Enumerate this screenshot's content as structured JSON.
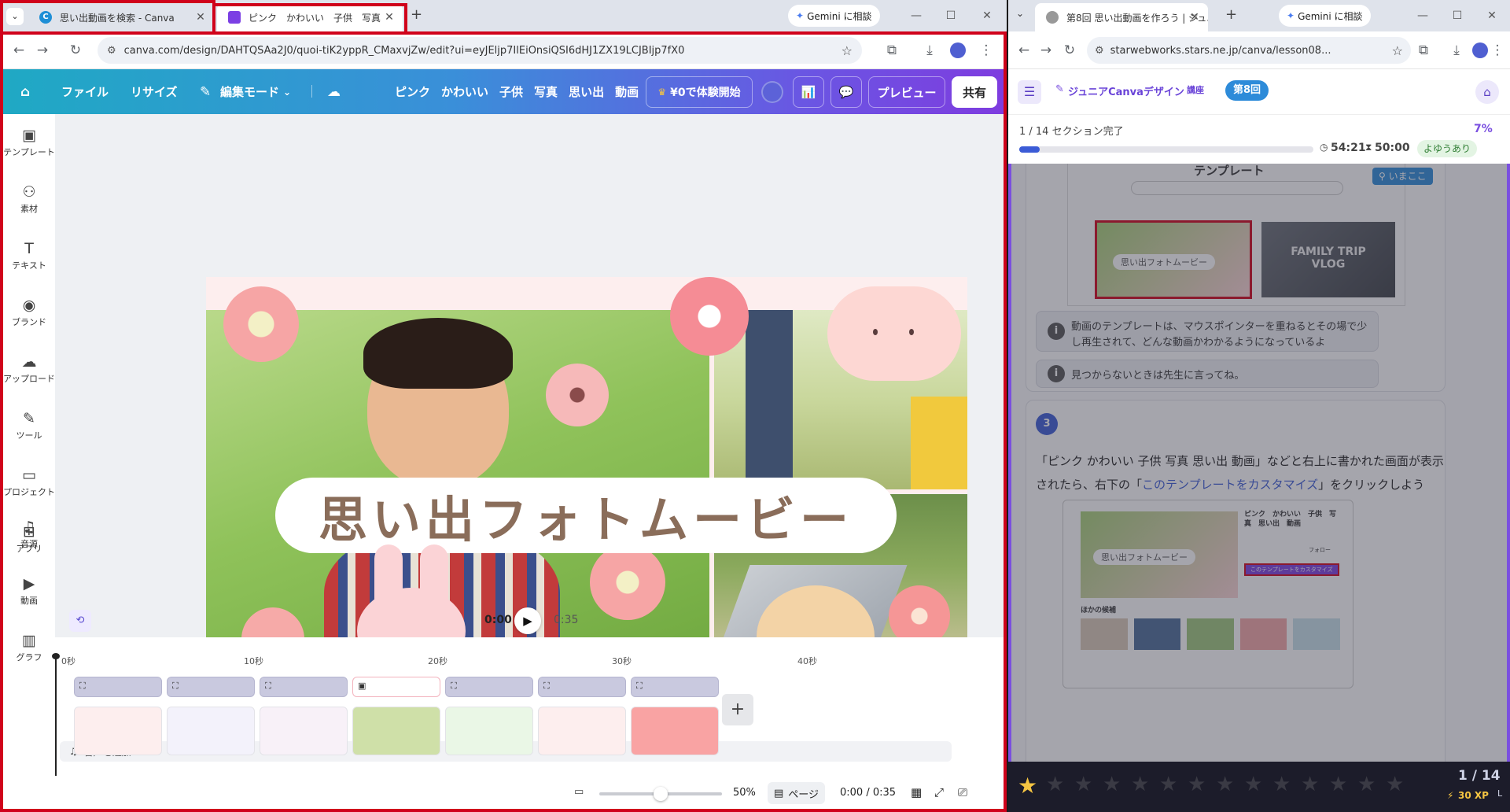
{
  "left_window": {
    "tabs": [
      {
        "title": "思い出動画を検索 - Canva"
      },
      {
        "title": "ピンク　かわいい　子供　写真"
      }
    ],
    "gemini": "Gemini に相談",
    "url": "canva.com/design/DAHTQSAa2J0/quoi-tiK2yppR_CMaxvjZw/edit?ui=eyJEljp7IlEiOnsiQSI6dHJ1ZX19LCJBIjp7fX0"
  },
  "canva": {
    "header": {
      "file": "ファイル",
      "resize": "リサイズ",
      "edit_mode": "編集モード",
      "keywords": [
        "ピンク",
        "かわいい",
        "子供",
        "写真",
        "思い出",
        "動画"
      ],
      "trial": "¥0で体験開始",
      "preview": "プレビュー",
      "share": "共有"
    },
    "sidebar": [
      {
        "label": "テンプレート",
        "icon": "template-icon"
      },
      {
        "label": "素材",
        "icon": "elements-icon"
      },
      {
        "label": "テキスト",
        "icon": "text-icon"
      },
      {
        "label": "ブランド",
        "icon": "brand-icon"
      },
      {
        "label": "アップロード",
        "icon": "upload-icon"
      },
      {
        "label": "ツール",
        "icon": "tools-icon"
      },
      {
        "label": "プロジェクト",
        "icon": "folder-icon"
      },
      {
        "label": "アプリ",
        "icon": "apps-icon"
      },
      {
        "label": "音源",
        "icon": "music-icon"
      },
      {
        "label": "動画",
        "icon": "video-icon"
      },
      {
        "label": "グラフ",
        "icon": "chart-icon"
      }
    ],
    "design_title": "思い出フォトムービー",
    "playback": {
      "current": "0:00",
      "total": "0:35"
    },
    "ruler": [
      "0秒",
      "10秒",
      "20秒",
      "30秒",
      "40秒"
    ],
    "add_audio": "音声を追加",
    "status": {
      "zoom": "50%",
      "zoom_level": 0.5,
      "pages": "ページ",
      "time": "0:00 / 0:35"
    }
  },
  "right_window": {
    "tab": "第8回 思い出動画を作ろう | ジュニ",
    "gemini": "Gemini に相談",
    "url": "starwebworks.stars.ne.jp/canva/lesson08...",
    "course": "ジュニアCanvaデザイン",
    "course_badge": "講座",
    "lesson_badge": "第8回",
    "progress_text": "1 / 14 セクション完了",
    "progress_pct": "7%",
    "progress_fraction": 0.07,
    "timer1": "54:21",
    "timer2": "50:00",
    "timer_status": "よゆうあり",
    "shot1": {
      "heading": "テンプレート",
      "here_tag": "いまここ",
      "thumb2_title": "FAMILY TRIP VLOG",
      "thumb1_title": "思い出フォトムービー"
    },
    "notes": [
      "動画のテンプレートは、マウスポインターを重ねるとその場で少し再生されて、どんな動画かわかるようになっているよ",
      "見つからないときは先生に言ってね。"
    ],
    "step_no": "3",
    "step_text_1": "「ピンク かわいい 子供 写真 思い出 動画」などと右上に書かれた画面が表示されたら、右下の「",
    "step_link": "このテンプレートをカスタマイズ",
    "step_text_2": "」をクリックしよう",
    "shot2": {
      "title": "ピンク　かわいい　子供　写真　思い出　動画",
      "customize": "このテンプレートをカスタマイズ",
      "follow": "フォロー",
      "others": "ほかの候補",
      "thumb_title": "思い出フォトムービー"
    },
    "footer": {
      "count": "1 / 14",
      "xp": "30 XP",
      "level": "L"
    }
  }
}
